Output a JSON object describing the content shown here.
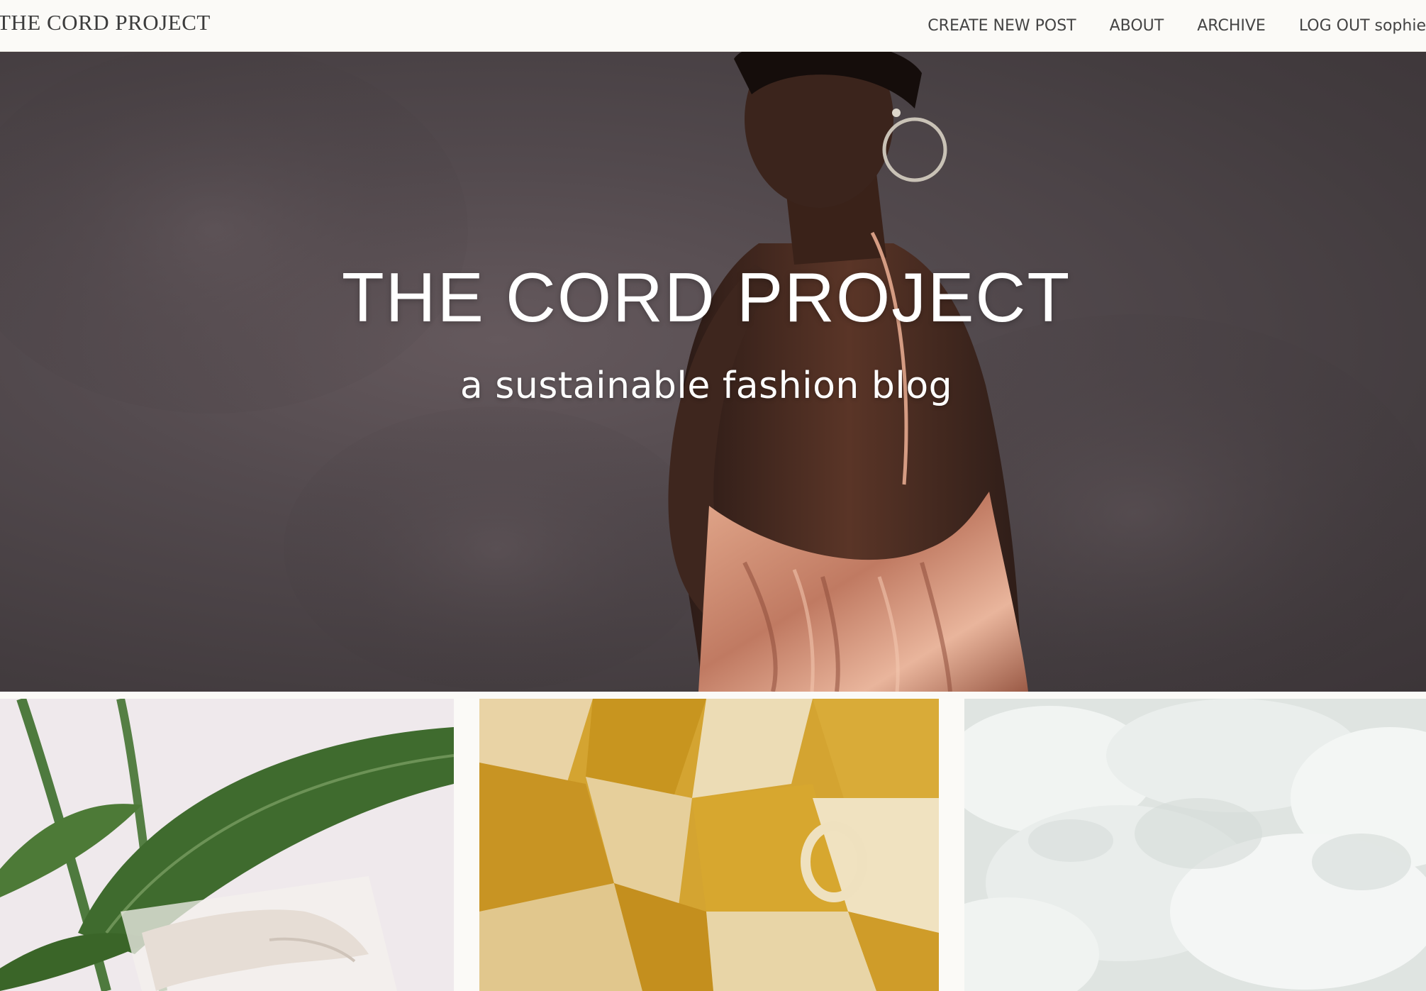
{
  "navbar": {
    "brand": "THE CORD PROJECT",
    "links": [
      {
        "label": "CREATE NEW POST"
      },
      {
        "label": "ABOUT"
      },
      {
        "label": "ARCHIVE"
      },
      {
        "label": "LOG OUT sophie"
      }
    ]
  },
  "hero": {
    "title": "THE CORD PROJECT",
    "subtitle": "a sustainable fashion blog"
  },
  "colors": {
    "background": "#fbfaf7",
    "nav_text": "#444444",
    "hero_backdrop": "#4a4246",
    "hero_text": "#ffffff"
  },
  "posts": [
    {
      "image": "leaf-and-hand-photo"
    },
    {
      "image": "mustard-fabric-scraps-photo"
    },
    {
      "image": "white-cotton-fibre-photo"
    }
  ]
}
